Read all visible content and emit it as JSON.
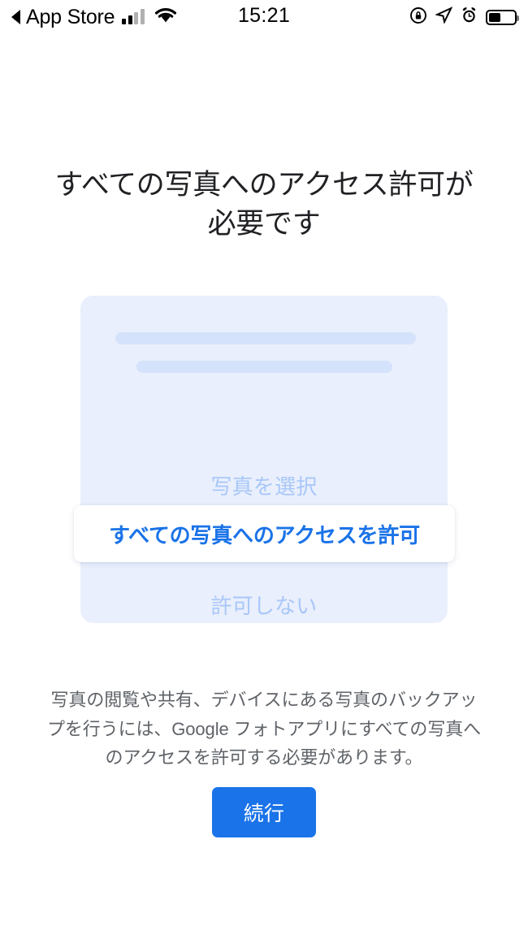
{
  "status_bar": {
    "back_label": "App Store",
    "back_icon": "back-triangle-icon",
    "signal_icon": "cellular-signal-icon",
    "wifi_icon": "wifi-icon",
    "time": "15:21",
    "rotation_lock_icon": "rotation-lock-icon",
    "location_icon": "location-arrow-icon",
    "alarm_icon": "alarm-clock-icon",
    "battery_icon": "battery-icon",
    "battery_level": 45
  },
  "page": {
    "title": "すべての写真へのアクセス許可が必要です",
    "body": "写真の閲覧や共有、デバイスにある写真のバックアップを行うには、Google フォトアプリにすべての写真へのアクセスを許可する必要があります。"
  },
  "illustration": {
    "option_select_photos": "写真を選択",
    "option_allow_all": "すべての写真へのアクセスを許可",
    "option_deny": "許可しない"
  },
  "cta": {
    "label": "続行"
  },
  "colors": {
    "accent_blue": "#1a73e8",
    "card_background": "#e9effc",
    "placeholder_bar": "#d4e2fb",
    "muted_option_text": "#a9c7f9",
    "body_text": "#5f6368",
    "title_text": "#202124"
  }
}
